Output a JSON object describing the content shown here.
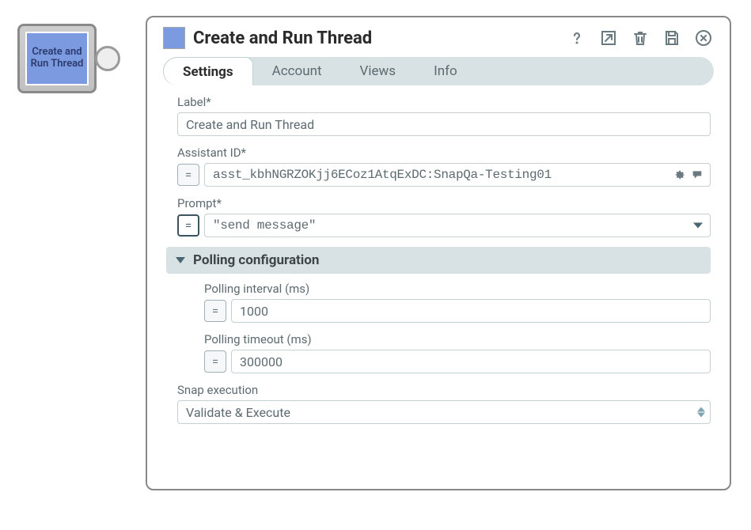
{
  "node": {
    "label": "Create and Run Thread"
  },
  "header": {
    "title": "Create and Run Thread"
  },
  "tabs": [
    {
      "label": "Settings",
      "active": true
    },
    {
      "label": "Account",
      "active": false
    },
    {
      "label": "Views",
      "active": false
    },
    {
      "label": "Info",
      "active": false
    }
  ],
  "form": {
    "label": {
      "label": "Label*",
      "value": "Create and Run Thread"
    },
    "assistant_id": {
      "label": "Assistant ID*",
      "value": "asst_kbhNGRZOKjj6ECoz1AtqExDC:SnapQa-Testing01"
    },
    "prompt": {
      "label": "Prompt*",
      "value": "\"send message\""
    },
    "section_title": "Polling configuration",
    "polling_interval": {
      "label": "Polling interval (ms)",
      "value": "1000"
    },
    "polling_timeout": {
      "label": "Polling timeout (ms)",
      "value": "300000"
    },
    "snap_execution": {
      "label": "Snap execution",
      "value": "Validate & Execute"
    }
  }
}
